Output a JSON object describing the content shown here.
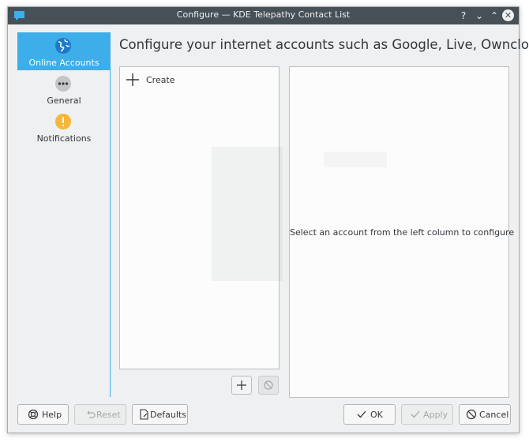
{
  "window": {
    "title": "Configure — KDE Telepathy Contact List"
  },
  "titlebar_buttons": {
    "help": "?",
    "minimize": "⌄",
    "maximize": "⌃",
    "close": "✕"
  },
  "sidebar": {
    "items": [
      {
        "label": "Online Accounts",
        "icon": "globe-icon",
        "selected": true
      },
      {
        "label": "General",
        "icon": "more-dots-icon",
        "selected": false
      },
      {
        "label": "Notifications",
        "icon": "warning-icon",
        "selected": false
      }
    ]
  },
  "main": {
    "header": "Configure your internet accounts such as Google, Live, Owncloud",
    "create_label": "Create",
    "detail_message": "Select an account from the left column to configure"
  },
  "buttons": {
    "help": "Help",
    "reset": "Reset",
    "defaults": "Defaults",
    "ok": "OK",
    "apply": "Apply",
    "cancel": "Cancel"
  },
  "colors": {
    "accent": "#3daee9",
    "titlebar": "#475057",
    "warning": "#f5b63a",
    "window_bg": "#eff0f1"
  }
}
